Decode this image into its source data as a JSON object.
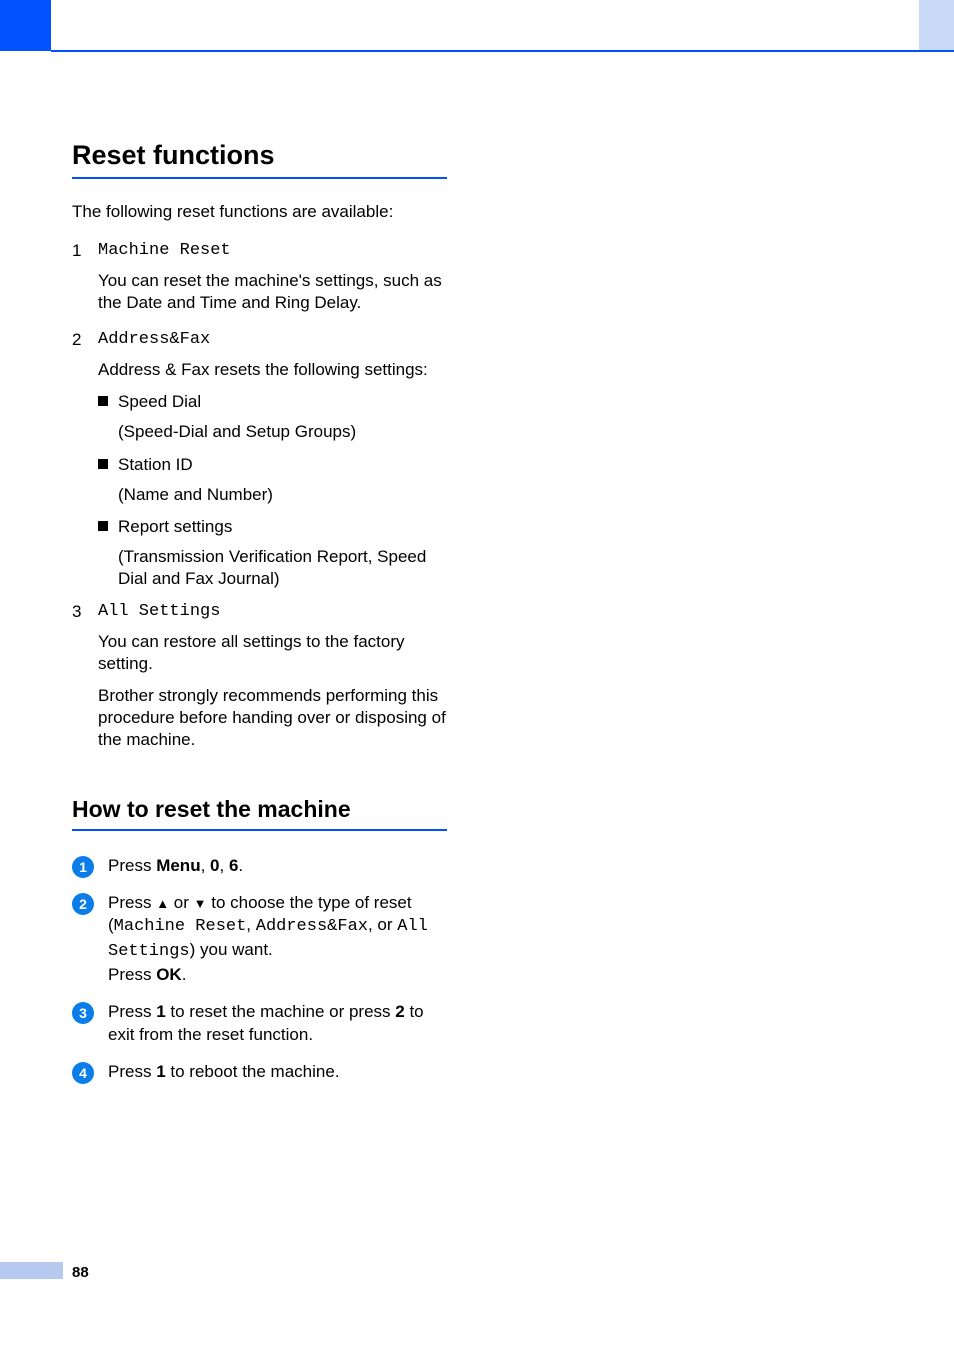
{
  "page_number": "88",
  "section1": {
    "title": "Reset functions",
    "intro": "The following reset functions are available:",
    "items": [
      {
        "num": "1",
        "mono_label": "Machine Reset",
        "paras": [
          "You can reset the machine's settings, such as the Date and Time and Ring Delay."
        ]
      },
      {
        "num": "2",
        "mono_label": "Address&Fax",
        "paras": [
          "Address & Fax resets the following settings:"
        ],
        "bullets": [
          {
            "label": "Speed Dial",
            "sub": "(Speed-Dial and Setup Groups)"
          },
          {
            "label": "Station ID",
            "sub": "(Name and Number)"
          },
          {
            "label": "Report settings",
            "sub": "(Transmission Verification Report, Speed Dial and Fax Journal)"
          }
        ]
      },
      {
        "num": "3",
        "mono_label": "All Settings",
        "paras": [
          "You can restore all settings to the factory setting.",
          "Brother strongly recommends performing this procedure before handing over or disposing of the machine."
        ]
      }
    ]
  },
  "section2": {
    "title": "How to reset the machine",
    "steps": [
      {
        "n": "1",
        "segments": [
          {
            "t": "Press "
          },
          {
            "t": "Menu",
            "b": true
          },
          {
            "t": ", "
          },
          {
            "t": "0",
            "b": true
          },
          {
            "t": ", "
          },
          {
            "t": "6",
            "b": true
          },
          {
            "t": "."
          }
        ]
      },
      {
        "n": "2",
        "segments": [
          {
            "t": "Press "
          },
          {
            "t": "▲",
            "arrow": true
          },
          {
            "t": " or "
          },
          {
            "t": "▼",
            "arrow": true
          },
          {
            "t": " to choose the type of reset ("
          },
          {
            "t": "Machine Reset",
            "mono": true
          },
          {
            "t": ", "
          },
          {
            "t": "Address&Fax",
            "mono": true
          },
          {
            "t": ", or "
          },
          {
            "t": "All Settings",
            "mono": true
          },
          {
            "t": ") you want."
          },
          {
            "br": true
          },
          {
            "t": "Press "
          },
          {
            "t": "OK",
            "b": true
          },
          {
            "t": "."
          }
        ]
      },
      {
        "n": "3",
        "segments": [
          {
            "t": "Press "
          },
          {
            "t": "1",
            "b": true
          },
          {
            "t": " to reset the machine or press "
          },
          {
            "t": "2",
            "b": true
          },
          {
            "t": " to exit from the reset function."
          }
        ]
      },
      {
        "n": "4",
        "segments": [
          {
            "t": "Press "
          },
          {
            "t": "1",
            "b": true
          },
          {
            "t": " to reboot the machine."
          }
        ]
      }
    ]
  }
}
